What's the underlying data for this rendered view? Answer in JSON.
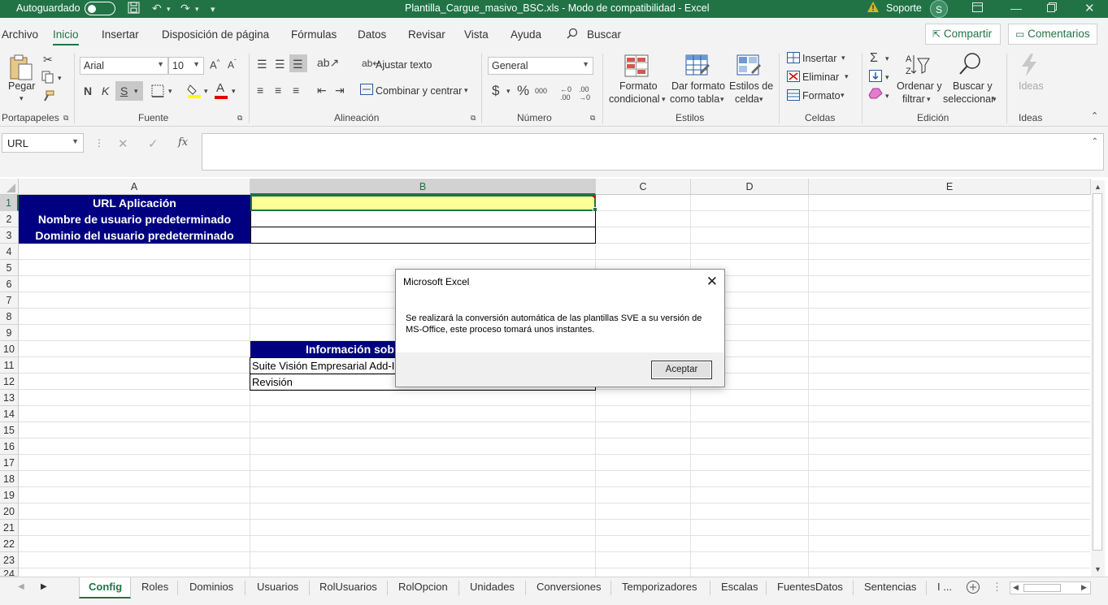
{
  "titlebar": {
    "autosave_label": "Autoguardado",
    "document_title": "Plantilla_Cargue_masivo_BSC.xls  -  Modo de compatibilidad  -  Excel",
    "support_label": "Soporte",
    "user_initial": "S",
    "bg_color": "#217346"
  },
  "menu": {
    "items": [
      "Archivo",
      "Inicio",
      "Insertar",
      "Disposición de página",
      "Fórmulas",
      "Datos",
      "Revisar",
      "Vista",
      "Ayuda"
    ],
    "search_label": "Buscar",
    "share_label": "Compartir",
    "comments_label": "Comentarios"
  },
  "ribbon": {
    "clipboard": {
      "paste": "Pegar",
      "group": "Portapapeles"
    },
    "font": {
      "name": "Arial",
      "size": "10",
      "bold": "N",
      "italic": "K",
      "underline": "S",
      "group": "Fuente"
    },
    "alignment": {
      "wrap": "Ajustar texto",
      "merge": "Combinar y centrar",
      "group": "Alineación"
    },
    "number": {
      "format": "General",
      "currency": "$",
      "percent": "%",
      "thousands": "000",
      "group": "Número"
    },
    "styles": {
      "conditional": [
        "Formato",
        "condicional"
      ],
      "as_table": [
        "Dar formato",
        "como tabla"
      ],
      "cell_styles": [
        "Estilos de",
        "celda"
      ],
      "group": "Estilos"
    },
    "cells": {
      "insert": "Insertar",
      "delete": "Eliminar",
      "format": "Formato",
      "group": "Celdas"
    },
    "editing": {
      "sort": [
        "Ordenar y",
        "filtrar"
      ],
      "find": [
        "Buscar y",
        "seleccionar"
      ],
      "group": "Edición"
    },
    "ideas": {
      "label": "Ideas",
      "group": "Ideas"
    }
  },
  "formula_bar": {
    "name_box": "URL",
    "fx": "fx",
    "formula": ""
  },
  "sheet": {
    "columns": [
      "A",
      "B",
      "C",
      "D",
      "E"
    ],
    "rows": [
      "1",
      "2",
      "3",
      "4",
      "5",
      "6",
      "7",
      "8",
      "9",
      "10",
      "11",
      "12",
      "13",
      "14",
      "15",
      "16",
      "17",
      "18",
      "19",
      "20",
      "21",
      "22",
      "23"
    ],
    "cells": {
      "A1": "URL Aplicación",
      "A2": "Nombre de usuario predeterminado",
      "A3": "Dominio del usuario predeterminado",
      "B10": "Información sob",
      "B11": "Suite Visión Empresarial Add-I",
      "B12": "Revisión"
    },
    "header_color": "#000080",
    "selected_fill": "#ffff99"
  },
  "dialog": {
    "title": "Microsoft Excel",
    "message": "Se realizará la conversión automática de las plantillas SVE a su versión de MS-Office, este proceso tomará unos instantes.",
    "ok": "Aceptar"
  },
  "tabs": {
    "items": [
      "Config",
      "Roles",
      "Dominios",
      "Usuarios",
      "RolUsuarios",
      "RolOpcion",
      "Unidades",
      "Conversiones",
      "Temporizadores",
      "Escalas",
      "FuentesDatos",
      "Sentencias"
    ],
    "active": "Config",
    "more": "I ..."
  }
}
